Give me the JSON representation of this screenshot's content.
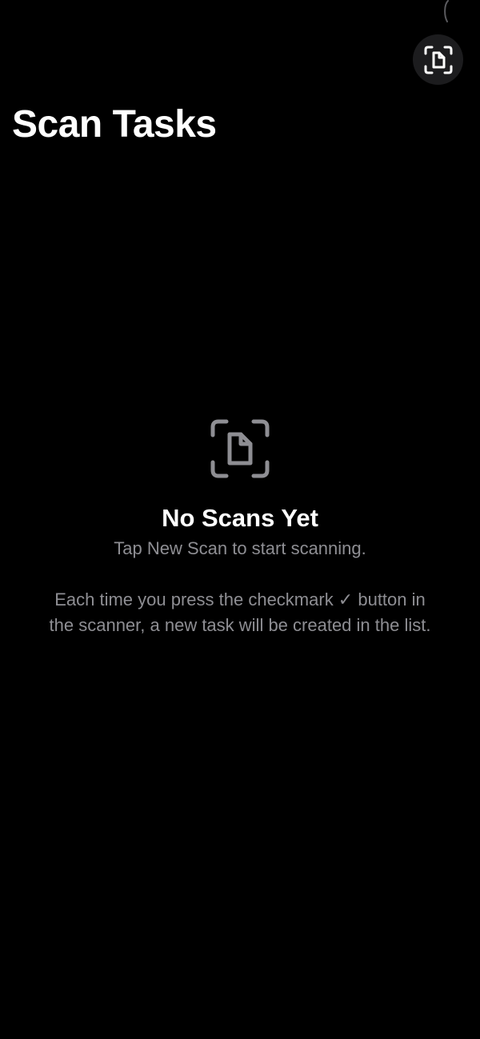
{
  "status": {
    "indicator_icon": "arc-indicator-icon"
  },
  "toolbar": {
    "scan_button_icon": "document-scanner-icon"
  },
  "header": {
    "title": "Scan Tasks"
  },
  "empty_state": {
    "icon": "document-scanner-icon",
    "title": "No Scans Yet",
    "subtitle": "Tap New Scan to start scanning.",
    "description": "Each time you press the checkmark ✓ button in the scanner, a new task will be created in the list."
  },
  "colors": {
    "background": "#000000",
    "primary_text": "#ffffff",
    "secondary_text": "#8e8e93",
    "button_background": "#1c1c1e",
    "icon_gray": "#8e8e93"
  }
}
